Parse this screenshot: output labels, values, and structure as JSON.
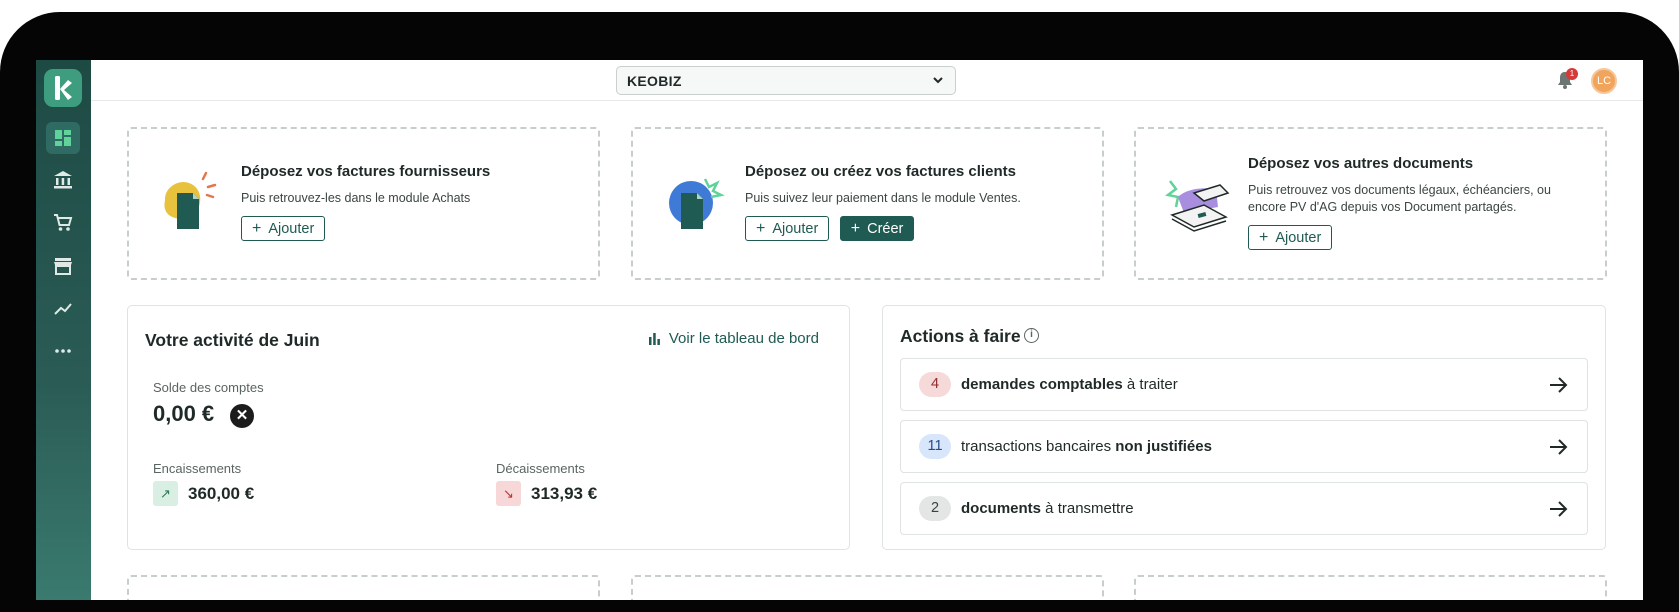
{
  "topbar": {
    "company": "KEOBIZ",
    "notifications_count": "1",
    "avatar_initials": "LC"
  },
  "sidebar": {
    "items": [
      {
        "icon": "dashboard-icon",
        "active": true
      },
      {
        "icon": "bank-icon",
        "active": false
      },
      {
        "icon": "cart-icon",
        "active": false
      },
      {
        "icon": "store-icon",
        "active": false
      },
      {
        "icon": "chart-line-icon",
        "active": false
      },
      {
        "icon": "more-icon",
        "active": false
      }
    ]
  },
  "upload_cards": [
    {
      "title": "Déposez vos factures fournisseurs",
      "subtitle": "Puis retrouvez-les dans le module Achats",
      "buttons": [
        "Ajouter"
      ]
    },
    {
      "title": "Déposez ou créez vos factures clients",
      "subtitle": "Puis suivez leur paiement dans le module Ventes.",
      "buttons": [
        "Ajouter",
        "Créer"
      ]
    },
    {
      "title": "Déposez vos autres documents",
      "subtitle_line1": "Puis retrouvez vos documents légaux, échéanciers, ou",
      "subtitle_line2": "encore PV d'AG depuis vos Document partagés.",
      "buttons": [
        "Ajouter"
      ]
    }
  ],
  "activity": {
    "title": "Votre activité de Juin",
    "dashboard_link": "Voir le tableau de bord",
    "balance_label": "Solde des comptes",
    "balance_value": "0,00 €",
    "inflows_label": "Encaissements",
    "inflows_value": "360,00 €",
    "outflows_label": "Décaissements",
    "outflows_value": "313,93 €"
  },
  "actions": {
    "title": "Actions à faire",
    "rows": [
      {
        "count": "4",
        "bold": "demandes comptables",
        "rest": " à traiter"
      },
      {
        "count": "11",
        "pre": "transactions bancaires ",
        "bold": "non justifiées"
      },
      {
        "count": "2",
        "bold": "documents",
        "rest": " à transmettre"
      }
    ]
  },
  "colors": {
    "brand": "#1f5b52",
    "sidebar": "#1e4a44",
    "danger_badge": "#d43a3a"
  }
}
